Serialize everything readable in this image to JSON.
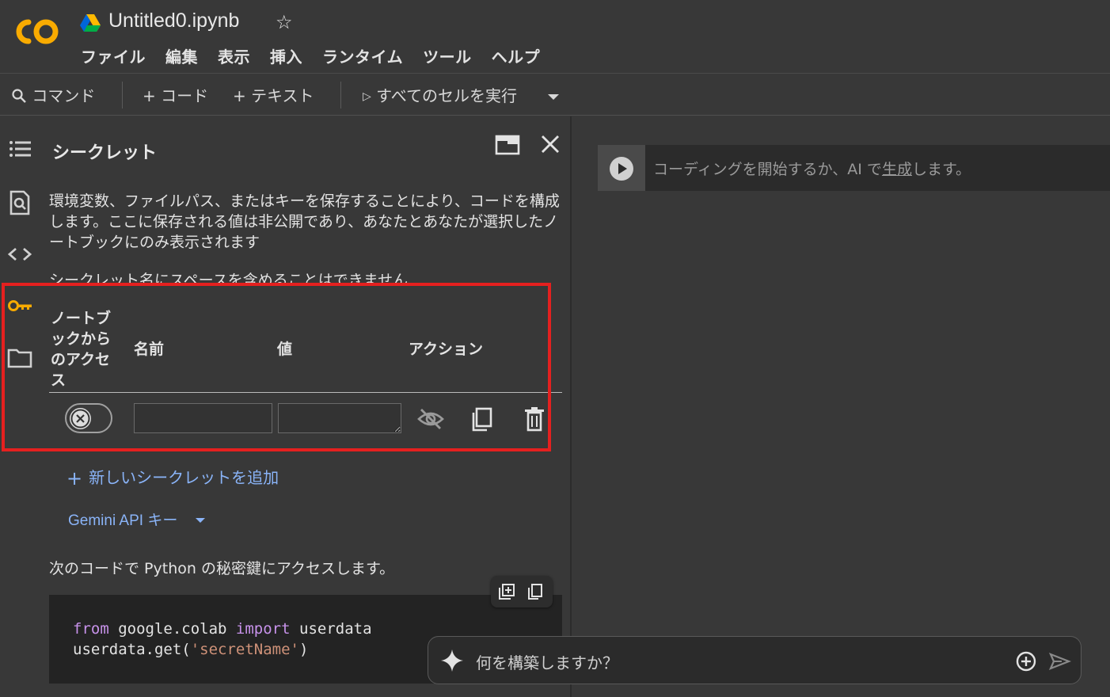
{
  "header": {
    "logo_text": "CO",
    "title": "Untitled0.ipynb",
    "star_icon": "star-icon",
    "menu": [
      "ファイル",
      "編集",
      "表示",
      "挿入",
      "ランタイム",
      "ツール",
      "ヘルプ"
    ]
  },
  "toolbar": {
    "command_label": "コマンド",
    "add_code_label": "+ コード",
    "add_text_label": "+ テキスト",
    "run_all_label": "すべてのセルを実行"
  },
  "sidebar": {
    "icons": [
      "toc-icon",
      "find-icon",
      "code-snippets-icon",
      "key-icon",
      "folder-icon"
    ],
    "active": "key-icon"
  },
  "secrets_panel": {
    "title": "シークレット",
    "description": "環境変数、ファイルパス、またはキーを保存することにより、コードを構成します。ここに保存される値は非公開であり、あなたとあなたが選択したノートブックにのみ表示されます",
    "note": "シークレット名にスペースを含めることはできません",
    "table": {
      "headers": {
        "access": "ノートブックからのアクセス",
        "name": "名前",
        "value": "値",
        "actions": "アクション"
      },
      "rows": [
        {
          "access_enabled": false,
          "name": "",
          "value": ""
        }
      ]
    },
    "add_secret_label": "新しいシークレットを追加",
    "gemini_key_label": "Gemini API キー",
    "access_text": "次のコードで Python の秘密鍵にアクセスします。",
    "code": {
      "line1_from": "from",
      "line1_module": " google.colab ",
      "line1_import": "import",
      "line1_name": " userdata",
      "line2_prefix": "userdata.get(",
      "line2_string": "'secretName'",
      "line2_suffix": ")"
    }
  },
  "main": {
    "cell_placeholder_prefix": "コーディングを開始するか、AI で",
    "cell_placeholder_link": "生成",
    "cell_placeholder_suffix": "します。"
  },
  "ai_bar": {
    "placeholder": "何を構築しますか？"
  },
  "colors": {
    "background": "#383838",
    "accent_link": "#8ab4f8",
    "highlight": "#e5201f",
    "logo": "#f9ab00",
    "active_icon": "#f9ab00"
  }
}
